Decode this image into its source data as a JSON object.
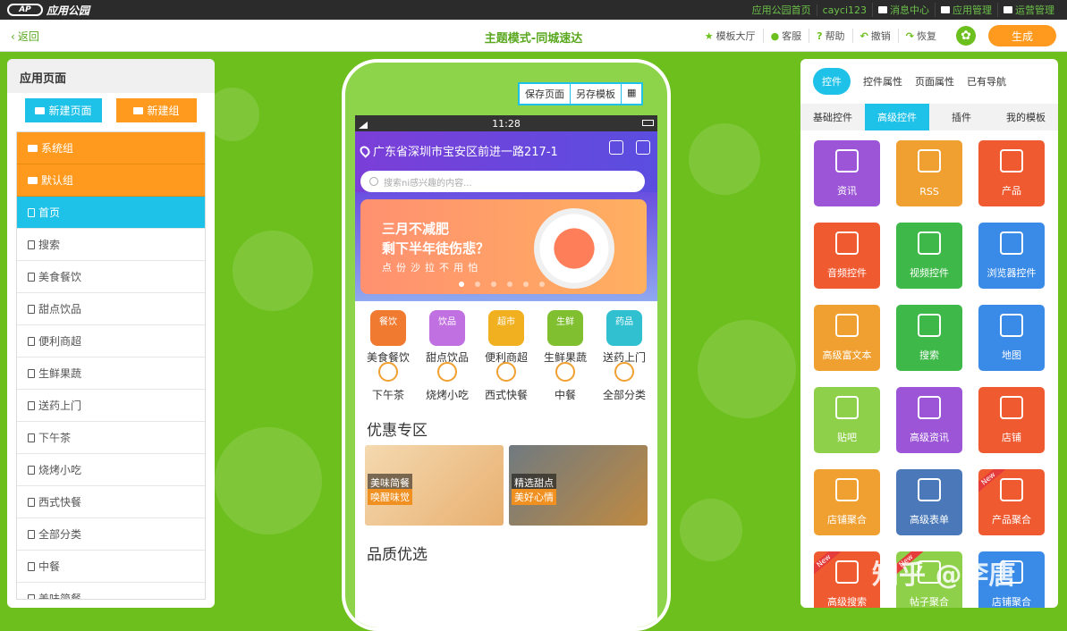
{
  "topbar": {
    "logo": "应用公园",
    "links": [
      "应用公园首页",
      "cayci123",
      "消息中心",
      "应用管理",
      "运营管理"
    ]
  },
  "toolbar": {
    "back": "返回",
    "title": "主题模式-同城速达",
    "tools": [
      "模板大厅",
      "客服",
      "帮助",
      "撤销",
      "恢复"
    ],
    "generate": "生成"
  },
  "left": {
    "title": "应用页面",
    "new_page": "新建页面",
    "new_group": "新建组",
    "items": [
      {
        "label": "系统组",
        "kind": "group"
      },
      {
        "label": "默认组",
        "kind": "group"
      },
      {
        "label": "首页",
        "kind": "active"
      },
      {
        "label": "搜索",
        "kind": "page"
      },
      {
        "label": "美食餐饮",
        "kind": "page"
      },
      {
        "label": "甜点饮品",
        "kind": "page"
      },
      {
        "label": "便利商超",
        "kind": "page"
      },
      {
        "label": "生鲜果蔬",
        "kind": "page"
      },
      {
        "label": "送药上门",
        "kind": "page"
      },
      {
        "label": "下午茶",
        "kind": "page"
      },
      {
        "label": "烧烤小吃",
        "kind": "page"
      },
      {
        "label": "西式快餐",
        "kind": "page"
      },
      {
        "label": "全部分类",
        "kind": "page"
      },
      {
        "label": "中餐",
        "kind": "page"
      },
      {
        "label": "美味简餐",
        "kind": "page"
      }
    ]
  },
  "phone": {
    "buttons": [
      "保存页面",
      "另存模板",
      "▦"
    ],
    "time": "11:28",
    "location": "广东省深圳市宝安区前进一路217-1",
    "search_placeholder": "搜索ni感兴趣的内容...",
    "banner": {
      "line1": "三月不减肥",
      "line2": "剩下半年徒伤悲？",
      "line3": "点份沙拉不用怕"
    },
    "categories": [
      {
        "tag": "餐饮",
        "label": "美食餐饮",
        "color": "#f07a30"
      },
      {
        "tag": "饮品",
        "label": "甜点饮品",
        "color": "#c070e0"
      },
      {
        "tag": "超市",
        "label": "便利商超",
        "color": "#f0b020"
      },
      {
        "tag": "生鲜",
        "label": "生鲜果蔬",
        "color": "#80c030"
      },
      {
        "tag": "药品",
        "label": "送药上门",
        "color": "#30c0d0"
      }
    ],
    "categories2": [
      "下午茶",
      "烧烤小吃",
      "西式快餐",
      "中餐",
      "全部分类"
    ],
    "section1": "优惠专区",
    "promos": [
      {
        "t1": "美味简餐",
        "t2": "唤醒味觉"
      },
      {
        "t1": "精选甜点",
        "t2": "美好心情"
      }
    ],
    "section2": "品质优选"
  },
  "right": {
    "tabs": [
      "控件",
      "控件属性",
      "页面属性",
      "已有导航"
    ],
    "subtabs": [
      "基础控件",
      "高级控件",
      "插件",
      "我的模板"
    ],
    "tiles": [
      {
        "label": "资讯",
        "color": "#9b55d6"
      },
      {
        "label": "RSS",
        "color": "#f0a030"
      },
      {
        "label": "产品",
        "color": "#f05a30"
      },
      {
        "label": "音频控件",
        "color": "#f05a30"
      },
      {
        "label": "视频控件",
        "color": "#3fb84a"
      },
      {
        "label": "浏览器控件",
        "color": "#3a8be8"
      },
      {
        "label": "高级富文本",
        "color": "#f0a030"
      },
      {
        "label": "搜索",
        "color": "#3fb84a"
      },
      {
        "label": "地图",
        "color": "#3a8be8"
      },
      {
        "label": "贴吧",
        "color": "#8fd04a"
      },
      {
        "label": "高级资讯",
        "color": "#9b55d6"
      },
      {
        "label": "店铺",
        "color": "#f05a30"
      },
      {
        "label": "店铺聚合",
        "color": "#f0a030"
      },
      {
        "label": "高级表单",
        "color": "#4a78b8"
      },
      {
        "label": "产品聚合",
        "color": "#f05a30"
      },
      {
        "label": "高级搜索",
        "color": "#f05a30"
      },
      {
        "label": "帖子聚合",
        "color": "#8fd04a"
      },
      {
        "label": "店铺聚合",
        "color": "#3a8be8"
      }
    ],
    "new_badge": "New"
  },
  "watermark": "知乎 @李唐"
}
